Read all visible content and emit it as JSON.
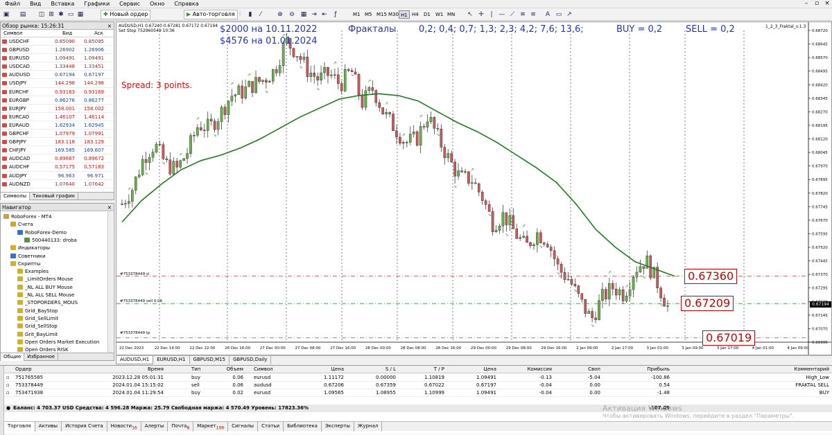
{
  "menu": [
    "Файл",
    "Вид",
    "Вставка",
    "Графики",
    "Сервис",
    "Окно",
    "Справка"
  ],
  "toolbar": {
    "new_order": "Новый ордер",
    "autotrading": "Авто-торговля",
    "timeframes": [
      "M1",
      "M5",
      "M15",
      "M30",
      "H1",
      "H4",
      "D1",
      "W1",
      "MN"
    ],
    "active_tf": "H1"
  },
  "market_watch": {
    "title": "Обзор рынка: 15:26:31",
    "col_symbol": "Символ",
    "col_bid": "Бид",
    "col_ask": "Аск",
    "rows": [
      {
        "s": "USDCHF",
        "b": "0.85090",
        "a": "0.85095"
      },
      {
        "s": "GBPUSD",
        "b": "1.26902",
        "a": "1.26906"
      },
      {
        "s": "EURUSD",
        "b": "1.09491",
        "a": "1.09491"
      },
      {
        "s": "USDCAD",
        "b": "1.33448",
        "a": "1.33451"
      },
      {
        "s": "AUDUSD",
        "b": "0.67194",
        "a": "0.67197"
      },
      {
        "s": "USDJPY",
        "b": "144.298",
        "a": "144.298"
      },
      {
        "s": "EURCHF",
        "b": "0.93163",
        "a": "0.93169"
      },
      {
        "s": "EURGBP",
        "b": "0.86276",
        "a": "0.86277"
      },
      {
        "s": "EURJPY",
        "b": "158.001",
        "a": "158.002"
      },
      {
        "s": "EURCAD",
        "b": "1.46107",
        "a": "1.46114"
      },
      {
        "s": "EURAUD",
        "b": "1.62934",
        "a": "1.62945"
      },
      {
        "s": "GBPCHF",
        "b": "1.07979",
        "a": "1.07991"
      },
      {
        "s": "GBPJPY",
        "b": "183.118",
        "a": "183.129"
      },
      {
        "s": "CHFJPY",
        "b": "169.585",
        "a": "169.607"
      },
      {
        "s": "AUDCAD",
        "b": "0.89667",
        "a": "0.89672"
      },
      {
        "s": "AUDCHF",
        "b": "0.57175",
        "a": "0.57183"
      },
      {
        "s": "AUDJPY",
        "b": "96.963",
        "a": "96.971"
      },
      {
        "s": "AUDNZD",
        "b": "1.07640",
        "a": "1.07642"
      }
    ],
    "tabs": [
      "Символы",
      "Тиковый график"
    ]
  },
  "navigator": {
    "title": "Навигатор",
    "items": [
      {
        "label": "RoboForex - MT4",
        "lvl": 0,
        "c": "#c9a23a"
      },
      {
        "label": "Счета",
        "lvl": 1,
        "c": "#c9a23a"
      },
      {
        "label": "RoboForex-Demo",
        "lvl": 2,
        "c": "#3b6fc9"
      },
      {
        "label": "500440133: droba",
        "lvl": 3,
        "c": "#4a9a3a"
      },
      {
        "label": "Индикаторы",
        "lvl": 1,
        "c": "#d4b020"
      },
      {
        "label": "Советники",
        "lvl": 1,
        "c": "#3b6fc9"
      },
      {
        "label": "Скрипты",
        "lvl": 1,
        "c": "#d4b020"
      },
      {
        "label": "Examples",
        "lvl": 2,
        "c": "#d4b020"
      },
      {
        "label": "_LimitOrders Mouse",
        "lvl": 2,
        "c": "#d4b020"
      },
      {
        "label": "_NL ALL BUY Mouse",
        "lvl": 2,
        "c": "#d4b020"
      },
      {
        "label": "_NL ALL SELL Mouse",
        "lvl": 2,
        "c": "#d4b020"
      },
      {
        "label": "_STOPORDERS_MOUS",
        "lvl": 2,
        "c": "#d4b020"
      },
      {
        "label": "Grid_BayStop",
        "lvl": 2,
        "c": "#d4b020"
      },
      {
        "label": "Grid_SellLimit",
        "lvl": 2,
        "c": "#d4b020"
      },
      {
        "label": "Grid_SellStop",
        "lvl": 2,
        "c": "#d4b020"
      },
      {
        "label": "Grit_BayLimit",
        "lvl": 2,
        "c": "#d4b020"
      },
      {
        "label": "Open Orders Market Execution",
        "lvl": 2,
        "c": "#d4b020"
      },
      {
        "label": "Open Orders RISK",
        "lvl": 2,
        "c": "#d4b020"
      }
    ],
    "tabs": [
      "Общие",
      "Избранное"
    ]
  },
  "chart": {
    "symbol_line": "AUDUSD,H1  0.67240 0.67281 0.67172 0.67194",
    "setstop": "Set Stop 752960549 10:36",
    "indicator_name": "1_2_3_Fraktal_v.1.3",
    "annot_money1": "$2000  на 10.11.2022",
    "annot_money2": "$4576 на 01.01.2024",
    "annot_fractals": "Фракталы",
    "annot_values": "0,2; 0,4; 0,7; 1,3; 2,3; 4,2; 7,6; 13,6;",
    "annot_buy": "BUY = 0,2",
    "annot_sell": "SELL = 0,2",
    "annot_spread": "Spread: 3 points.",
    "level_labels": {
      "sl": "#753378449 sl",
      "sell": "#753378449 sell 0.06",
      "tp": "#753378449 tp"
    },
    "boxes": [
      "0.67360",
      "0.67209",
      "0.67019"
    ],
    "price_current": "0.67194",
    "price_ticks": [
      "0.68720",
      "0.68645",
      "0.68570",
      "0.68495",
      "0.68420",
      "0.68345",
      "0.68270",
      "0.68195",
      "0.68120",
      "0.68045",
      "0.67970",
      "0.67895",
      "0.67820",
      "0.67745",
      "0.67670",
      "0.67595",
      "0.67520",
      "0.67445",
      "0.67370",
      "0.67295",
      "0.67220",
      "0.67145",
      "0.67070",
      "0.66995"
    ],
    "time_ticks": [
      "22 Dec 2023",
      "22 Dec 14:00",
      "22 Dec 22:00",
      "26 Dec 16:00",
      "27 Dec 00:00",
      "27 Dec 08:00",
      "27 Dec 16:00",
      "28 Dec 00:00",
      "28 Dec 08:00",
      "28 Dec 16:00",
      "29 Dec 00:00",
      "29 Dec 08:00",
      "29 Dec 16:00",
      "2 Jan 09:00",
      "2 Jan 17:00",
      "3 Jan 01:00",
      "3 Jan 09:00",
      "3 Jan 17:00",
      "4 Jan 01:00",
      "4 Jan 09:00"
    ],
    "tabs": [
      "AUDUSD,H1",
      "EURUSD,H1",
      "GBPUSD,M15",
      "GBPUSD,Daily"
    ]
  },
  "terminal": {
    "headers": [
      "Ордер",
      "Время",
      "Тип",
      "Объем",
      "Символ",
      "Цена",
      "S / L",
      "T / P",
      "Цена",
      "Комиссия",
      "Своп",
      "Прибыль",
      "Комментарий"
    ],
    "rows": [
      [
        "751765585",
        "2023.12.28 05:01:31",
        "buy",
        "0.06",
        "eurusd",
        "1.11172",
        "0.00000",
        "1.10819",
        "1.09491",
        "-0.13",
        "-5.04",
        "-100.86",
        "High_Low"
      ],
      [
        "753378449",
        "2024.01.04 15:15:02",
        "sell",
        "0.06",
        "audusd",
        "0.67206",
        "0.67359",
        "0.67022",
        "0.67197",
        "-0.04",
        "0.00",
        "0.54",
        "FRAKTAL SELL"
      ],
      [
        "753471938",
        "2024.01.04 11:29:54",
        "buy",
        "0.02",
        "eurusd",
        "1.09565",
        "1.08955",
        "1.10999",
        "1.09491",
        "-0.04",
        "0.00",
        "-1.48",
        "BUY"
      ]
    ],
    "balance": "Баланс: 4 703.37 USD  Средства: 4 596.28  Маржа: 25.79  Свободная маржа: 4 570.49  Уровень: 17823.36%",
    "total": "-107.09",
    "tabs": [
      "Торговля",
      "Активы",
      "История Счета",
      "Новости",
      "Алерты",
      "Почта",
      "Маркет",
      "Сигналы",
      "Статьи",
      "Библиотека",
      "Эксперты",
      "Журнал"
    ],
    "tab_badges": {
      "news": "16",
      "mail": "8",
      "market": "109"
    },
    "activation1": "Активация Windows",
    "activation2": "Чтобы активировать Windows, перейдите в раздел \"Параметры\"."
  },
  "chart_data": {
    "type": "candlestick",
    "symbol": "AUDUSD",
    "timeframe": "H1",
    "ylim": [
      0.66995,
      0.6872
    ],
    "levels": {
      "sl": 0.6736,
      "open": 0.67209,
      "tp": 0.67019
    },
    "close_path": [
      0.6776,
      0.6785,
      0.6802,
      0.6809,
      0.6798,
      0.6795,
      0.6805,
      0.682,
      0.6818,
      0.6826,
      0.6836,
      0.6838,
      0.6842,
      0.6845,
      0.685,
      0.6866,
      0.686,
      0.685,
      0.6845,
      0.6848,
      0.6842,
      0.685,
      0.6832,
      0.684,
      0.6826,
      0.6818,
      0.681,
      0.6812,
      0.6825,
      0.6812,
      0.68,
      0.679,
      0.679,
      0.678,
      0.6765,
      0.677,
      0.676,
      0.6752,
      0.676,
      0.6756,
      0.674,
      0.6734,
      0.6722,
      0.6712,
      0.6724,
      0.673,
      0.6726,
      0.674,
      0.6745,
      0.6733,
      0.6719
    ],
    "ma_path": [
      0.6766,
      0.6778,
      0.6787,
      0.6795,
      0.68,
      0.6803,
      0.6807,
      0.6812,
      0.6818,
      0.6824,
      0.6829,
      0.6834,
      0.6836,
      0.6837,
      0.6836,
      0.6833,
      0.6827,
      0.6821,
      0.6816,
      0.681,
      0.6803,
      0.6796,
      0.6788,
      0.6776,
      0.6762,
      0.6752,
      0.6744,
      0.674,
      0.6736
    ]
  }
}
